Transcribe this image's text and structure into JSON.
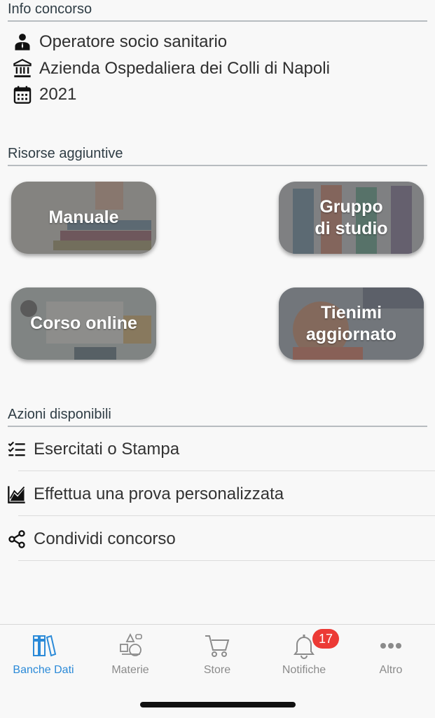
{
  "info": {
    "title": "Info concorso",
    "role": "Operatore socio sanitario",
    "institution": "Azienda Ospedaliera dei Colli di Napoli",
    "year": "2021"
  },
  "resources": {
    "title": "Risorse aggiuntive",
    "tiles": [
      {
        "label": "Manuale"
      },
      {
        "label_line1": "Gruppo",
        "label_line2": "di studio"
      },
      {
        "label": "Corso online"
      },
      {
        "label_line1": "Tienimi",
        "label_line2": "aggiornato"
      }
    ]
  },
  "actions": {
    "title": "Azioni disponibili",
    "items": [
      {
        "label": "Esercitati o Stampa",
        "icon": "checklist-icon"
      },
      {
        "label": "Effettua una prova personalizzata",
        "icon": "chart-icon"
      },
      {
        "label": "Condividi concorso",
        "icon": "share-icon"
      }
    ]
  },
  "tabbar": {
    "tabs": [
      {
        "label": "Banche Dati",
        "icon": "books-icon",
        "active": true
      },
      {
        "label": "Materie",
        "icon": "subjects-icon"
      },
      {
        "label": "Store",
        "icon": "cart-icon"
      },
      {
        "label": "Notifiche",
        "icon": "bell-icon",
        "badge": "17"
      },
      {
        "label": "Altro",
        "icon": "more-icon"
      }
    ]
  },
  "colors": {
    "accent": "#2b8ad8",
    "badge": "#ec3a35",
    "tile_overlay": "#696969"
  }
}
